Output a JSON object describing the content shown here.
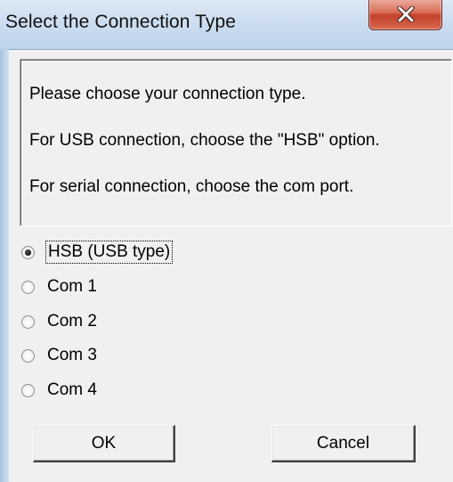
{
  "window": {
    "title": "Select the Connection Type",
    "close_icon": "close-x-icon",
    "close_color": "#c7422b"
  },
  "message": {
    "lines": [
      "Please choose your connection type.",
      "For USB connection, choose the \"HSB\" option.",
      "For serial connection, choose the com port."
    ]
  },
  "options": [
    {
      "label": "HSB (USB type)",
      "selected": true
    },
    {
      "label": "Com 1",
      "selected": false
    },
    {
      "label": "Com 2",
      "selected": false
    },
    {
      "label": "Com 3",
      "selected": false
    },
    {
      "label": "Com 4",
      "selected": false
    }
  ],
  "buttons": {
    "ok": "OK",
    "cancel": "Cancel"
  }
}
